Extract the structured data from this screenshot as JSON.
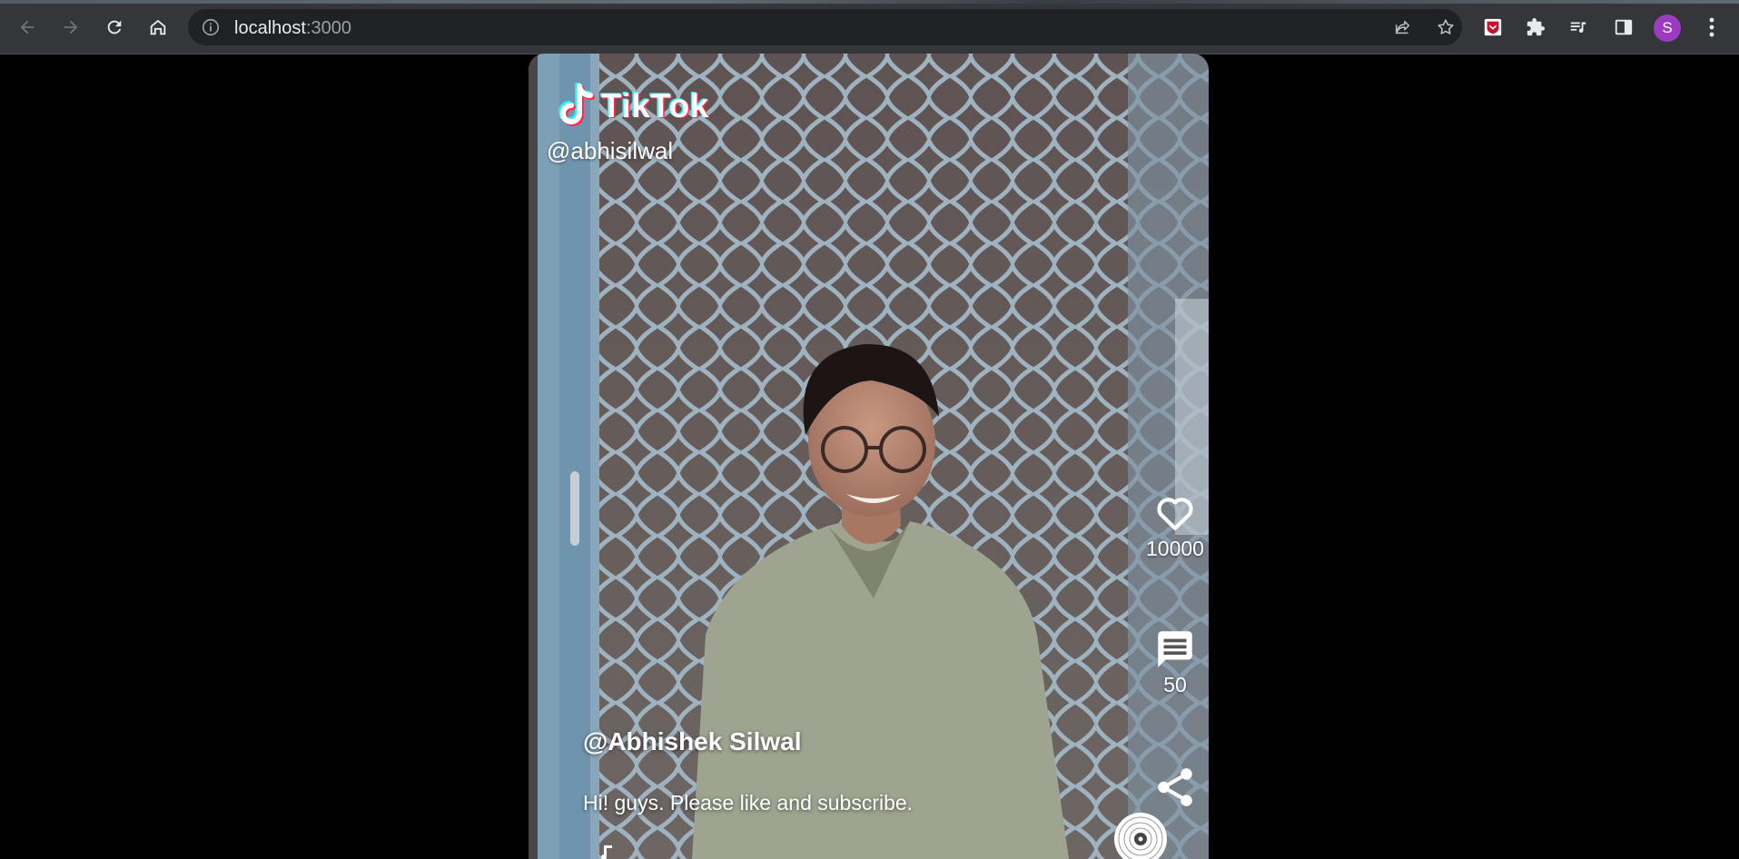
{
  "browser": {
    "url_host": "localhost",
    "url_port": ":3000",
    "profile_initial": "S"
  },
  "video": {
    "logo_text": "TikTok",
    "top_handle": "@abhisilwal",
    "author": "@Abhishek Silwal",
    "caption": "Hi! guys. Please like and subscribe.",
    "likes": "10000",
    "comments": "50"
  },
  "colors": {
    "chrome_bg": "#35363a",
    "omnibox_bg": "#202124",
    "page_bg": "#000000",
    "avatar": "#9c3bc2",
    "tiktok_cyan": "#25f4ee",
    "tiktok_red": "#fe2c55"
  },
  "icons": [
    "back-arrow-icon",
    "forward-arrow-icon",
    "reload-icon",
    "home-icon",
    "site-info-icon",
    "share-page-icon",
    "bookmark-star-icon",
    "extension-shield-icon",
    "extensions-puzzle-icon",
    "media-queue-icon",
    "side-panel-icon",
    "more-menu-icon",
    "heart-icon",
    "comment-icon",
    "share-icon",
    "music-disc-icon",
    "music-note-icon"
  ]
}
